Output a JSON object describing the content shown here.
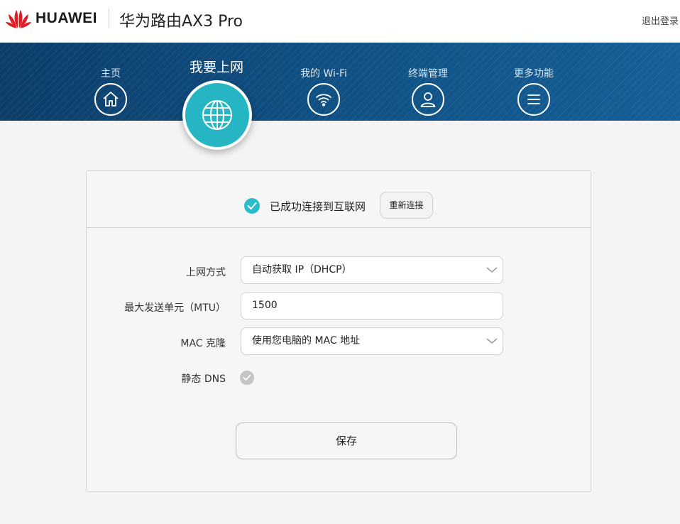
{
  "header": {
    "brand": "HUAWEI",
    "product": "华为路由AX3 Pro",
    "logout": "退出登录",
    "logo_icon": "huawei-logo",
    "logo_color": "#e01a22"
  },
  "nav": {
    "items": [
      {
        "label": "主页",
        "icon": "home-icon"
      },
      {
        "label": "我要上网",
        "icon": "globe-icon",
        "active": true
      },
      {
        "label": "我的 Wi-Fi",
        "icon": "wifi-icon"
      },
      {
        "label": "终端管理",
        "icon": "user-icon"
      },
      {
        "label": "更多功能",
        "icon": "menu-icon"
      }
    ],
    "active_color": "#26b6c3"
  },
  "status": {
    "text": "已成功连接到互联网",
    "reconnect": "重新连接",
    "icon": "check-circle-icon"
  },
  "form": {
    "mode_label": "上网方式",
    "mode_value": "自动获取 IP（DHCP）",
    "mtu_label": "最大发送单元（MTU）",
    "mtu_value": "1500",
    "mac_label": "MAC 克隆",
    "mac_value": "使用您电脑的 MAC 地址",
    "dns_label": "静态 DNS",
    "dns_checked": false,
    "save": "保存"
  }
}
